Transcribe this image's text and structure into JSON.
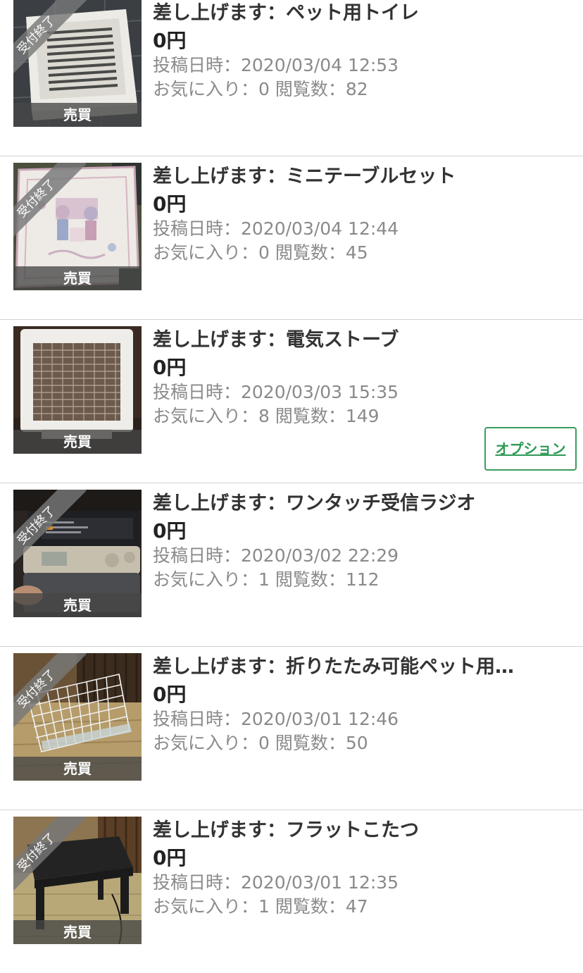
{
  "items": [
    {
      "title": "差し上げます：ペット用トイレ",
      "price": "0円",
      "posted": "投稿日時：2020/03/04 12:53",
      "stats": "お気に入り：0 閲覧数：82",
      "ribbon": "受付終了",
      "trade_type": "売買",
      "image": "pet-toilet-photo"
    },
    {
      "title": "差し上げます：ミニテーブルセット",
      "price": "0円",
      "posted": "投稿日時：2020/03/04 12:44",
      "stats": "お気に入り：0 閲覧数：45",
      "ribbon": "受付終了",
      "trade_type": "売買",
      "image": "mini-table-photo"
    },
    {
      "title": "差し上げます：電気ストーブ",
      "price": "0円",
      "posted": "投稿日時：2020/03/03 15:35",
      "stats": "お気に入り：8 閲覧数：149",
      "trade_type": "売買",
      "image": "electric-heater-photo",
      "option_label": "オプション"
    },
    {
      "title": "差し上げます：ワンタッチ受信ラジオ",
      "price": "0円",
      "posted": "投稿日時：2020/03/02 22:29",
      "stats": "お気に入り：1 閲覧数：112",
      "ribbon": "受付終了",
      "trade_type": "売買",
      "image": "radio-photo"
    },
    {
      "title": "差し上げます：折りたたみ可能ペット用…",
      "price": "0円",
      "posted": "投稿日時：2020/03/01 12:46",
      "stats": "お気に入り：0 閲覧数：50",
      "ribbon": "受付終了",
      "trade_type": "売買",
      "image": "pet-cage-photo"
    },
    {
      "title": "差し上げます：フラットこたつ",
      "price": "0円",
      "posted": "投稿日時：2020/03/01 12:35",
      "stats": "お気に入り：1 閲覧数：47",
      "ribbon": "受付終了",
      "trade_type": "売買",
      "image": "kotatsu-photo"
    }
  ],
  "colors": {
    "option_accent": "#2e9a55",
    "meta_text": "#8a8a8a",
    "divider": "#d2d2d2"
  }
}
